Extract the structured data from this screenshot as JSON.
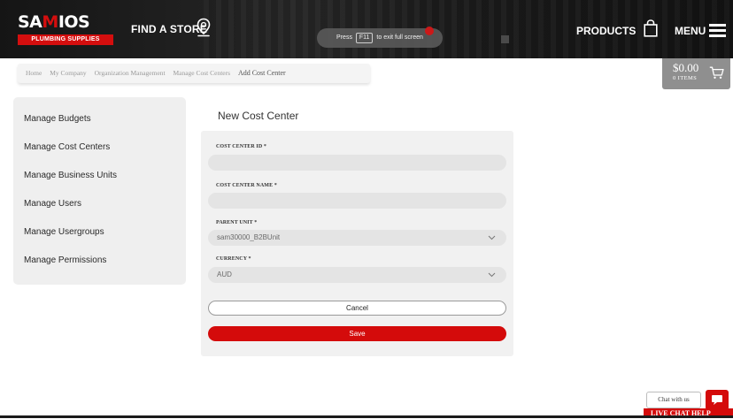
{
  "header": {
    "logo_main_1": "SA",
    "logo_main_2": "M",
    "logo_main_3": "IOS",
    "logo_sub": "PLUMBING SUPPLIES",
    "find_store": "FIND A STORE",
    "fullscreen_press": "Press",
    "fullscreen_key": "F11",
    "fullscreen_suffix": "to exit full screen",
    "products": "PRODUCTS",
    "menu": "MENU"
  },
  "breadcrumb": [
    "Home",
    "My Company",
    "Organization Management",
    "Manage Cost Centers",
    "Add Cost Center"
  ],
  "cart": {
    "amount": "$0.00",
    "items": "0 ITEMS"
  },
  "sidebar": {
    "items": [
      {
        "label": "Manage Budgets"
      },
      {
        "label": "Manage Cost Centers"
      },
      {
        "label": "Manage Business Units"
      },
      {
        "label": "Manage Users"
      },
      {
        "label": "Manage Usergroups"
      },
      {
        "label": "Manage Permissions"
      }
    ]
  },
  "form": {
    "title": "New Cost Center",
    "cost_center_id": {
      "label": "COST CENTER ID *",
      "value": ""
    },
    "cost_center_name": {
      "label": "COST CENTER NAME *",
      "value": ""
    },
    "parent_unit": {
      "label": "PARENT UNIT *",
      "value": "sam30000_B2BUnit"
    },
    "currency": {
      "label": "CURRENCY *",
      "value": "AUD"
    },
    "cancel_label": "Cancel",
    "save_label": "Save"
  },
  "chat": {
    "bubble": "Chat with us",
    "live_label": "LIVE CHAT HELP"
  },
  "colors": {
    "brand_red": "#d40b0b",
    "header_bg": "#1c1c1c",
    "panel_bg": "#efefef"
  },
  "icons": [
    "location-pin-icon",
    "shopping-bag-icon",
    "hamburger-menu-icon",
    "cart-icon",
    "chevron-down-icon",
    "chat-icon"
  ]
}
